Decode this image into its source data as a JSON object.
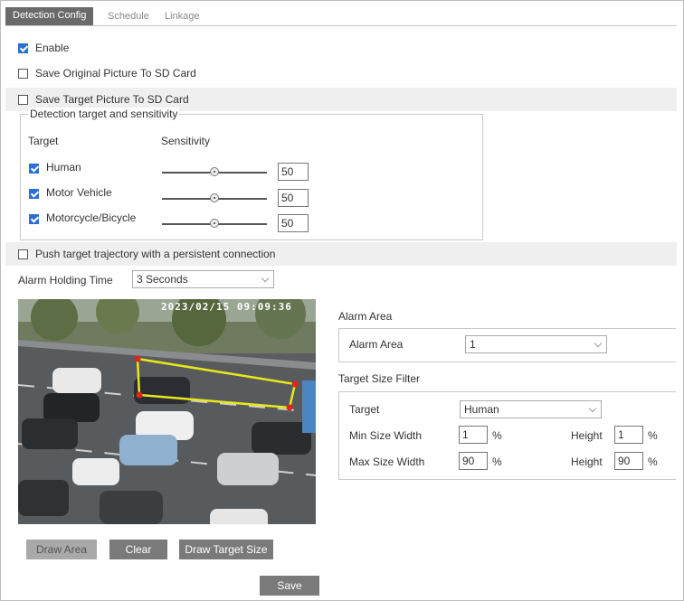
{
  "tabs": [
    {
      "label": "Detection Config",
      "active": true
    },
    {
      "label": "Schedule",
      "active": false
    },
    {
      "label": "Linkage",
      "active": false
    }
  ],
  "options": {
    "enable": {
      "label": "Enable",
      "checked": true
    },
    "save_original": {
      "label": "Save Original Picture To SD Card",
      "checked": false
    },
    "save_target": {
      "label": "Save Target Picture To SD Card",
      "checked": false
    },
    "push_trajectory": {
      "label": "Push target trajectory with a persistent connection",
      "checked": false
    }
  },
  "detection": {
    "legend": "Detection target and sensitivity",
    "col_target": "Target",
    "col_sensitivity": "Sensitivity",
    "targets": [
      {
        "label": "Human",
        "checked": true,
        "value": "50",
        "level": 0.5
      },
      {
        "label": "Motor Vehicle",
        "checked": true,
        "value": "50",
        "level": 0.5
      },
      {
        "label": "Motorcycle/Bicycle",
        "checked": true,
        "value": "50",
        "level": 0.5
      }
    ]
  },
  "alarm_holding": {
    "label": "Alarm Holding Time",
    "value": "3 Seconds"
  },
  "video": {
    "timestamp": "2023/02/15 09:09:36"
  },
  "buttons": {
    "draw_area": "Draw Area",
    "clear": "Clear",
    "draw_target_size": "Draw Target Size",
    "save": "Save"
  },
  "alarm_area": {
    "section_title": "Alarm Area",
    "label": "Alarm Area",
    "value": "1"
  },
  "target_size_filter": {
    "section_title": "Target Size Filter",
    "target_label": "Target",
    "target_value": "Human",
    "min_label": "Min Size Width",
    "min_width": "1",
    "min_height_label": "Height",
    "min_height": "1",
    "max_label": "Max Size Width",
    "max_width": "90",
    "max_height_label": "Height",
    "max_height": "90",
    "unit": "%"
  },
  "colors": {
    "accent": "#2a6fd6",
    "tab_active": "#6a6a6a",
    "region_line": "#e8e81a",
    "region_point": "#e0261c"
  }
}
